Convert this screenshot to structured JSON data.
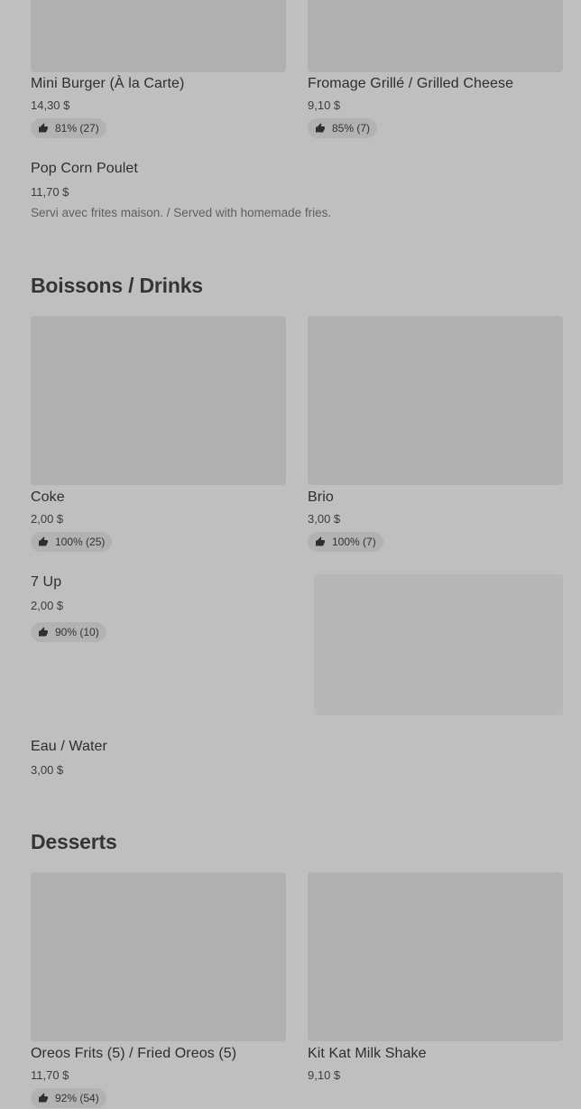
{
  "items_top": [
    {
      "name": "Mini Burger (À la Carte)",
      "price": "14,30 $",
      "rating": "81% (27)"
    },
    {
      "name": "Fromage Grillé / Grilled Cheese",
      "price": "9,10 $",
      "rating": "85% (7)"
    },
    {
      "name": "Pop Corn Poulet",
      "price": "11,70 $",
      "description": "Servi avec frites maison. / Served with homemade fries."
    }
  ],
  "drinks": {
    "title": "Boissons / Drinks",
    "items": [
      {
        "name": "Coke",
        "price": "2,00 $",
        "rating": "100% (25)"
      },
      {
        "name": "Brio",
        "price": "3,00 $",
        "rating": "100% (7)"
      },
      {
        "name": "7 Up",
        "price": "2,00 $",
        "rating": "90% (10)"
      },
      {
        "name": "Eau / Water",
        "price": "3,00 $"
      }
    ]
  },
  "desserts": {
    "title": "Desserts",
    "items": [
      {
        "name": "Oreos Frits (5) / Fried Oreos (5)",
        "price": "11,70 $",
        "rating": "92% (54)"
      },
      {
        "name": "Kit Kat Milk Shake",
        "price": "9,10 $"
      }
    ]
  }
}
